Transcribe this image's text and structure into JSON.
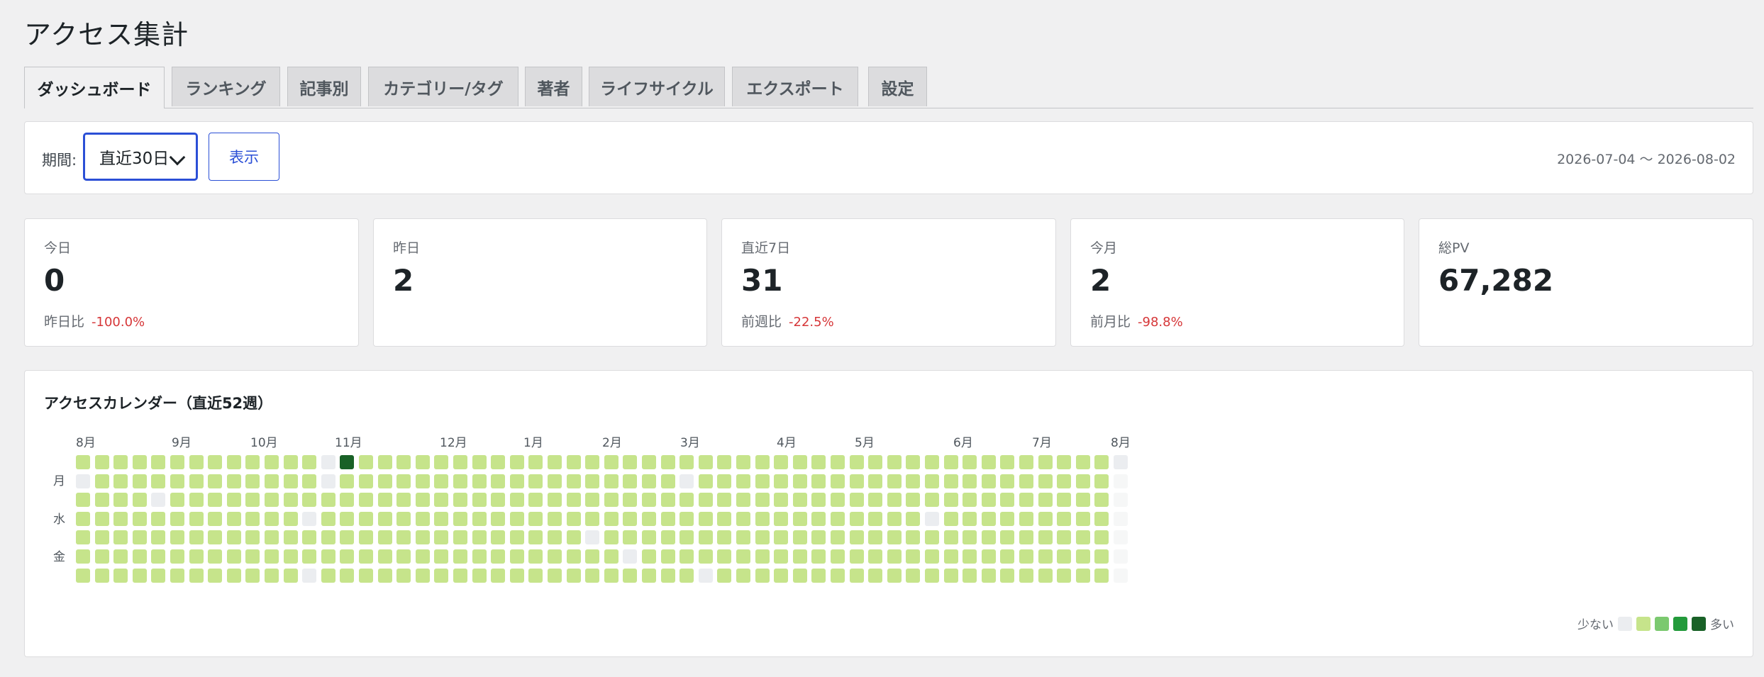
{
  "page": {
    "title": "アクセス集計"
  },
  "tabs": [
    {
      "label": "ダッシュボード",
      "active": true
    },
    {
      "label": "ランキング"
    },
    {
      "label": "記事別"
    },
    {
      "label": "カテゴリー/タグ"
    },
    {
      "label": "著者"
    },
    {
      "label": "ライフサイクル"
    },
    {
      "label": "エクスポート"
    },
    {
      "label": "設定"
    }
  ],
  "period": {
    "label": "期間:",
    "selected": "直近30日",
    "show_button": "表示",
    "date_range": "2026-07-04 〜 2026-08-02"
  },
  "stats": [
    {
      "label": "今日",
      "value": "0",
      "compare_label": "昨日比",
      "change": "-100.0%"
    },
    {
      "label": "昨日",
      "value": "2",
      "compare_label": "",
      "change": ""
    },
    {
      "label": "直近7日",
      "value": "31",
      "compare_label": "前週比",
      "change": "-22.5%"
    },
    {
      "label": "今月",
      "value": "2",
      "compare_label": "前月比",
      "change": "-98.8%"
    },
    {
      "label": "総PV",
      "value": "67,282",
      "compare_label": "",
      "change": ""
    }
  ],
  "calendar": {
    "title": "アクセスカレンダー（直近52週）",
    "months": [
      "8月",
      "9月",
      "10月",
      "11月",
      "12月",
      "1月",
      "2月",
      "3月",
      "4月",
      "5月",
      "6月",
      "7月",
      "8月"
    ],
    "day_labels": [
      "月",
      "水",
      "金"
    ],
    "legend_less": "少ない",
    "legend_more": "多い",
    "colors": {
      "empty": "#ebedf0",
      "lvl1": "#c6e48b",
      "lvl2": "#7bc96f",
      "lvl3": "#239a3b",
      "lvl4": "#196127",
      "future": "#f6f7f7"
    }
  }
}
